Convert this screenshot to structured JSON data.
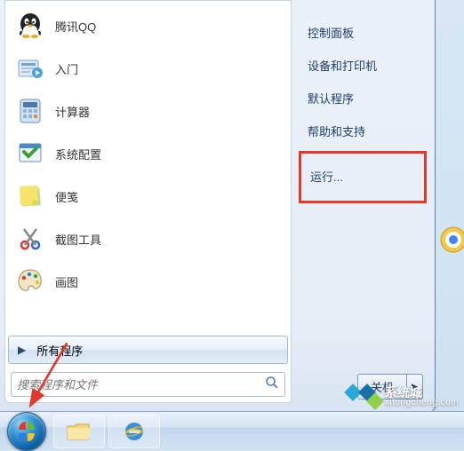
{
  "programs": [
    {
      "id": "qq",
      "label": "腾讯QQ",
      "icon": "qq"
    },
    {
      "id": "getting",
      "label": "入门",
      "icon": "getting-started"
    },
    {
      "id": "calc",
      "label": "计算器",
      "icon": "calculator"
    },
    {
      "id": "msconfig",
      "label": "系统配置",
      "icon": "msconfig"
    },
    {
      "id": "sticky",
      "label": "便笺",
      "icon": "sticky-notes"
    },
    {
      "id": "snip",
      "label": "截图工具",
      "icon": "snipping"
    },
    {
      "id": "paint",
      "label": "画图",
      "icon": "paint"
    }
  ],
  "all_programs_label": "所有程序",
  "search_placeholder": "搜索程序和文件",
  "right_menu": {
    "control_panel": "控制面板",
    "devices": "设备和打印机",
    "default_programs": "默认程序",
    "help": "帮助和支持",
    "run": "运行..."
  },
  "shutdown_label": "关机",
  "watermark": {
    "title": "系统城",
    "url": "xitongcheng.com"
  },
  "colors": {
    "highlight_red": "#e23a2a",
    "accent_blue": "#3a8fd8"
  }
}
